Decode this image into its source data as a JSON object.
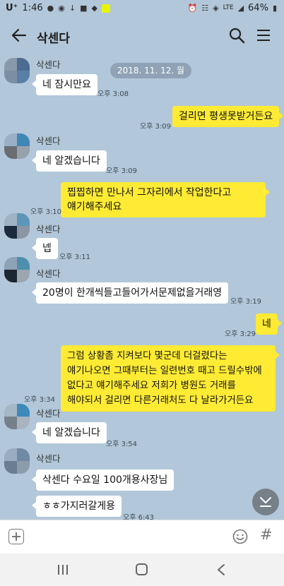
{
  "status_bar": {
    "carrier": "U⁺",
    "time": "1:46",
    "battery": "64%",
    "network": "LTE"
  },
  "header": {
    "title": "삭센다"
  },
  "chat": {
    "date_chip": "2018. 11. 12. 월",
    "messages": [
      {
        "dir": "in",
        "sender": "삭센다",
        "text": "네 잠시만요",
        "time": "오후 3:08"
      },
      {
        "dir": "out",
        "text": "걸리면 평생못받거든요",
        "time": "오후 3:09"
      },
      {
        "dir": "in",
        "sender": "삭센다",
        "text": "네 알겠습니다",
        "time": "오후 3:09"
      },
      {
        "dir": "out",
        "lines": [
          "찝찝하면 만나서 그자리에서 작업한다고",
          "얘기해주세요"
        ],
        "time": "오후 3:10"
      },
      {
        "dir": "in",
        "sender": "삭센다",
        "text": "넵",
        "time": "오후 3:11"
      },
      {
        "dir": "in",
        "sender": "삭센다",
        "text": "20명이 한개씩들고들어가서문제없을거래영",
        "time": "오후 3:19"
      },
      {
        "dir": "out",
        "text": "네",
        "time": "오후 3:29"
      },
      {
        "dir": "out",
        "lines": [
          "그럼 상황좀 지켜보다 몇군데 더걸렸다는",
          "얘기나오면 그때부터는 일련번호 때고 드릴수밖에",
          "없다고 얘기해주세요 저희가 병원도 거래를",
          "해야되서 걸리면 다른거래처도 다 날라가거든요"
        ],
        "time": "오후 3:34"
      },
      {
        "dir": "in",
        "sender": "삭센다",
        "text": "네 알겠습니다",
        "time": "오후 3:54"
      },
      {
        "dir": "in",
        "sender": "삭센다",
        "text": "삭센다 수요일 100개용사장님"
      },
      {
        "dir": "in",
        "text": "ㅎㅎ가지러갈게용",
        "time": "오후 6:43"
      }
    ]
  },
  "input": {
    "placeholder": ""
  },
  "icons": {
    "back": "arrow-left-icon",
    "search": "search-icon",
    "menu": "hamburger-menu-icon",
    "plus": "plus-icon",
    "emoji": "emoji-icon",
    "hash": "#",
    "scroll": "chevron-down-icon"
  },
  "colors": {
    "chat_bg": "#b2c7d9",
    "out_bubble": "#ffeb33",
    "in_bubble": "#ffffff"
  }
}
